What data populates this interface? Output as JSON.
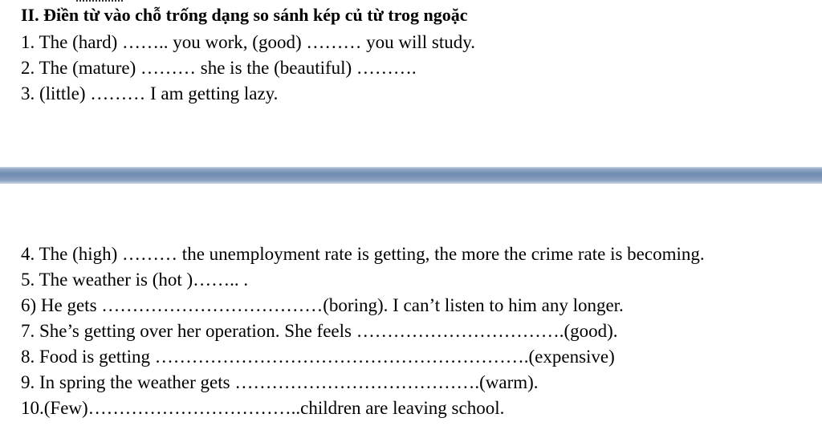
{
  "heading": "II. Điền từ vào chỗ trống dạng so sánh kép củ từ trog ngoặc",
  "items": [
    "1. The (hard) …….. you work, (good) ……… you will study.",
    "2. The (mature) ……… she is the (beautiful) ……….",
    "3. (little) ……… I am getting lazy.",
    "4. The (high) ……… the unemployment rate is getting, the more the crime rate is becoming.",
    "5. The weather is (hot )…….. .",
    "6)  He gets ………………………………(boring). I can’t listen to him any longer.",
    "7.  She’s getting over her operation. She feels …………………………….(good).",
    " 8.  Food is getting …………………………………………………….(expensive)",
    "  9. In spring the weather gets ………………………………….(warm).",
    "10.(Few)……………………………..children are leaving school."
  ]
}
